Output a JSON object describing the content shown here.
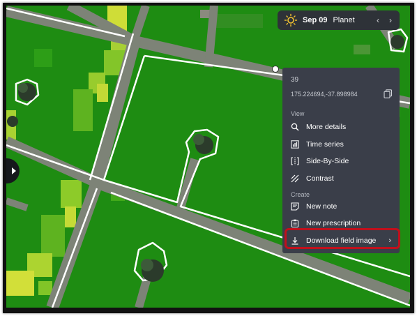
{
  "header": {
    "date": "Sep 09",
    "imagery_provider": "Planet",
    "prev_icon": "chevron-left-icon",
    "next_icon": "chevron-right-icon",
    "weather_icon": "sun-icon"
  },
  "context_menu": {
    "field_id": "39",
    "coordinates": "175.224694,-37.898984",
    "view_section": "View",
    "view_items": [
      {
        "label": "More details",
        "icon": "search-icon"
      },
      {
        "label": "Time series",
        "icon": "bar-chart-icon"
      },
      {
        "label": "Side-By-Side",
        "icon": "split-view-icon"
      },
      {
        "label": "Contrast",
        "icon": "contrast-icon"
      }
    ],
    "create_section": "Create",
    "create_items": [
      {
        "label": "New note",
        "icon": "note-icon"
      },
      {
        "label": "New prescription",
        "icon": "clipboard-icon"
      },
      {
        "label": "Download field image",
        "icon": "download-icon"
      }
    ],
    "highlighted_item": "Download field image"
  },
  "colors": {
    "field_green": "#1e8c12",
    "road_gray": "#7d8377",
    "menu_bg": "#3a3e49",
    "highlight_red": "#c0101c"
  }
}
